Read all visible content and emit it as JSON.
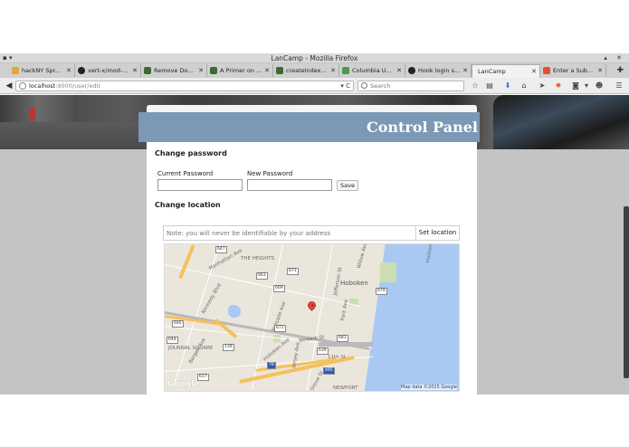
{
  "window": {
    "title": "LanCamp - Mozilla Firefox"
  },
  "tabs": [
    {
      "label": "hackNY Spr...",
      "favicon_color": "#e8a33a"
    },
    {
      "label": "vert-x/mod-...",
      "favicon_color": "#222222"
    },
    {
      "label": "Remove Do...",
      "favicon_color": "#3d6b2f"
    },
    {
      "label": "A Primer on ...",
      "favicon_color": "#3d6b2f"
    },
    {
      "label": "createIndex...",
      "favicon_color": "#3d6b2f"
    },
    {
      "label": "Columbia U...",
      "favicon_color": "#4a9a4a"
    },
    {
      "label": "Hook login s...",
      "favicon_color": "#222222"
    },
    {
      "label": "LanCamp",
      "favicon_color": "#ffffff",
      "active": true
    },
    {
      "label": "Enter a Sub...",
      "favicon_color": "#e04f3a"
    }
  ],
  "navbar": {
    "url_host": "localhost",
    "url_rest": ":9000/user/edit",
    "search_placeholder": "Search"
  },
  "page": {
    "panel_title": "Control Panel",
    "change_password": {
      "heading": "Change password",
      "current_label": "Current Password",
      "new_label": "New Password",
      "save_label": "Save"
    },
    "change_location": {
      "heading": "Change location",
      "input_placeholder": "Note: you will never be identifiable by your address",
      "set_label": "Set location"
    },
    "map": {
      "labels": {
        "heights": "THE HEIGHTS",
        "hoboken": "Hoboken",
        "journal_square": "JOURNAL SQUARE",
        "newport": "NEWPORT",
        "hudson_river": "Hudson River",
        "manhattan_ave": "Manhattan Ave",
        "kennedy_blvd": "Kennedy Blvd",
        "palisade_ave": "Palisade Ave",
        "hoboken_ave": "Hoboken Ave",
        "newark_st": "Newark St",
        "eleventh_st": "11th St",
        "willow_ave": "Willow Ave",
        "park_ave": "Park Ave",
        "jefferson_st": "Jefferson St",
        "jersey_ave": "Jersey Ave",
        "grove_st": "Grove St",
        "bergen_ave": "Bergen Ave",
        "route_139": "139",
        "route_78": "78",
        "route_495": "495"
      },
      "shields": [
        "647",
        "663",
        "671",
        "669",
        "679",
        "681",
        "671",
        "644",
        "646",
        "639",
        "617"
      ],
      "google_mark": "Google",
      "attribution": "Map data ©2015 Google"
    }
  }
}
